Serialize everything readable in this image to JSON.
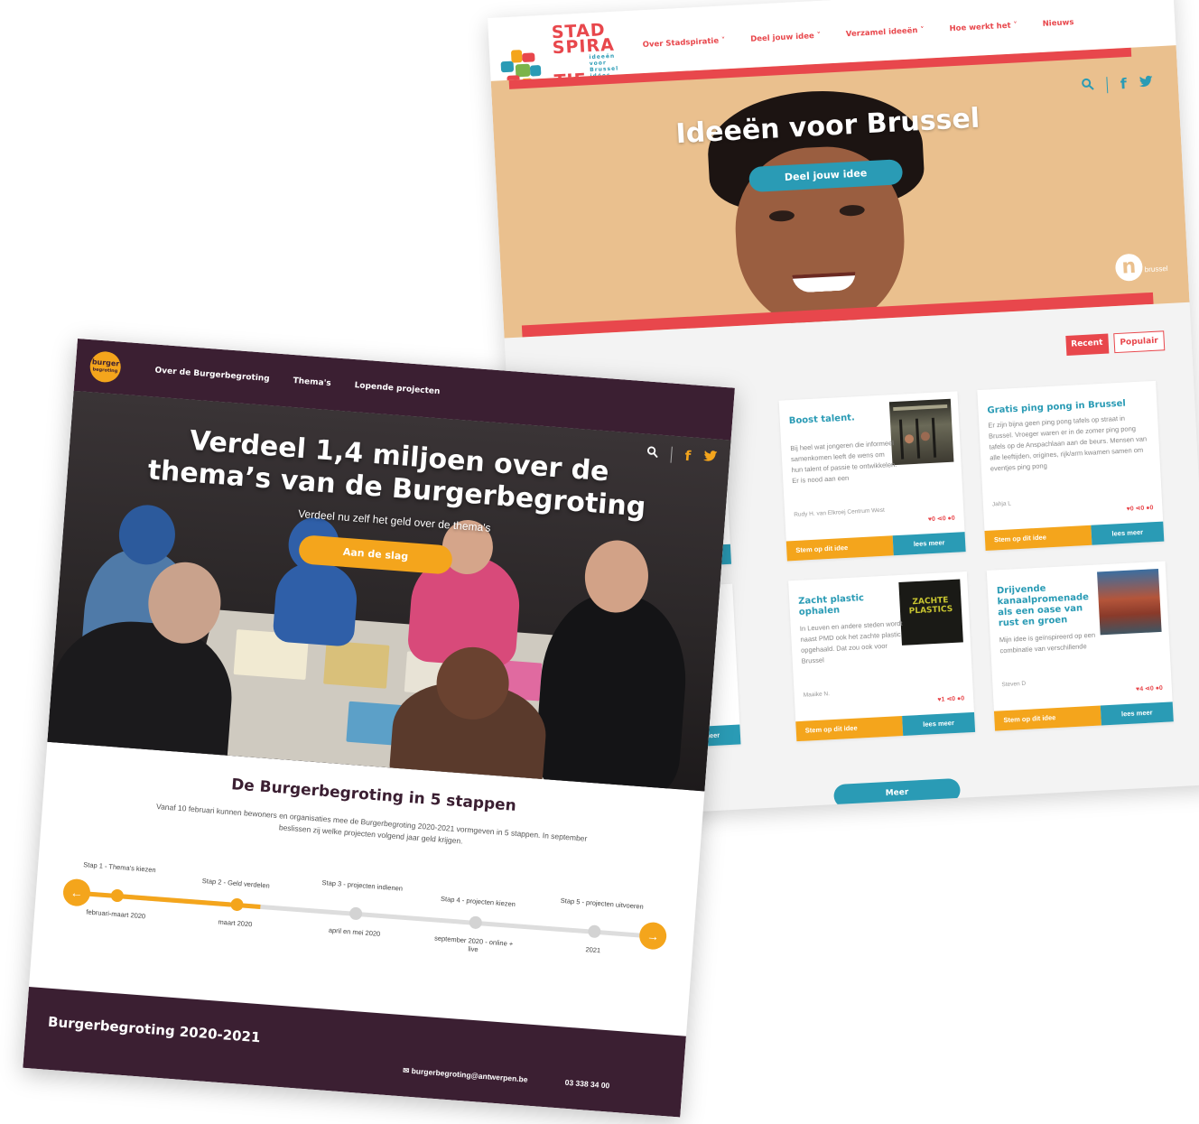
{
  "stadspiratie": {
    "logo": {
      "line1": "STAD",
      "line2": "SPIRA",
      "line3": "TIE",
      "tagline": "ideeën voor Brussel idées pour Bruxelles ideas for Brussels"
    },
    "nav": [
      "Over Stadspiratie ˅",
      "Deel jouw idee ˅",
      "Verzamel ideeën ˅",
      "Hoe werkt het ˅",
      "Nieuws"
    ],
    "hero": {
      "title": "Ideeën voor Brussel",
      "button": "Deel jouw idee",
      "partner_logo": "n",
      "partner_sub": "brussel"
    },
    "filters": {
      "recent": "Recent",
      "popular": "Populair"
    },
    "cards": [
      {
        "title": "Boost talent.",
        "text": "Bij heel wat jongeren die informeel samenkomen leeft de wens om hun talent of passie te ontwikkelen. Er is nood aan een",
        "author": "Rudy H. van Elkroej Centrum West",
        "stats": "♥0  ⋖0  ●0",
        "vote": "Stem op dit idee",
        "more": "lees meer"
      },
      {
        "title": "Gratis ping pong in Brussel",
        "text": "Er zijn bijna geen ping pong tafels op straat in Brussel. Vroeger waren er in de zomer ping pong tafels op de Anspachlaan aan de beurs. Mensen van alle leeftijden, origines, rijk/arm kwamen samen om eventjes ping pong",
        "author": "Jahja L",
        "stats": "♥0  ⋖0  ●0",
        "vote": "Stem op dit idee",
        "more": "lees meer"
      },
      {
        "title": "Zacht plastic ophalen",
        "text": "In Leuven en andere steden wordt naast PMD ook het zachte plastic opgehaald. Dat zou ook voor Brussel",
        "author": "Maaike N.",
        "stats": "♥1  ⋖0  ●0",
        "vote": "Stem op dit idee",
        "more": "lees meer",
        "img_text": "ZACHTE PLASTICS"
      },
      {
        "title": "Drijvende kanaalpromenade als een oase van rust en groen",
        "text": "Mijn idee is geïnspireerd op een combinatie van verschillende",
        "author": "Steven D",
        "stats": "♥4  ⋖0  ●0",
        "vote": "Stem op dit idee",
        "more": "lees meer"
      }
    ],
    "partial_more": [
      "neer",
      "lees meer"
    ],
    "meer_button": "Meer"
  },
  "burgerbegroting": {
    "logo": {
      "line1": "burger",
      "line2": "begroting"
    },
    "nav": [
      "Over de Burgerbegroting",
      "Thema's",
      "Lopende projecten"
    ],
    "hero": {
      "title": "Verdeel 1,4 miljoen over de thema’s van de Burgerbegroting",
      "subtitle": "Verdeel nu zelf het geld over de thema's",
      "button": "Aan de slag"
    },
    "steps_title": "De Burgerbegroting in 5 stappen",
    "steps_intro": "Vanaf 10 februari kunnen bewoners en organisaties mee de Burgerbegroting 2020-2021 vormgeven in 5 stappen. In september beslissen zij welke projecten volgend jaar geld krijgen.",
    "timeline_progress": 0.32,
    "steps": [
      {
        "label": "Stap 1 - Thema's kiezen",
        "date": "februari-maart 2020",
        "done": true
      },
      {
        "label": "Stap 2 - Geld verdelen",
        "date": "maart 2020",
        "done": true
      },
      {
        "label": "Stap 3 - projecten indienen",
        "date": "april en mei 2020",
        "done": false
      },
      {
        "label": "Stap 4 - projecten kiezen",
        "date": "september 2020 - online + live",
        "done": false
      },
      {
        "label": "Stap 5 - projecten uitvoeren",
        "date": "2021",
        "done": false
      }
    ],
    "footer": {
      "title": "Burgerbegroting 2020-2021",
      "email": "burgerbegroting@antwerpen.be",
      "phone": "03 338 34 00"
    },
    "colors": {
      "plum": "#3b1f32",
      "accent": "#f4a51c"
    }
  }
}
